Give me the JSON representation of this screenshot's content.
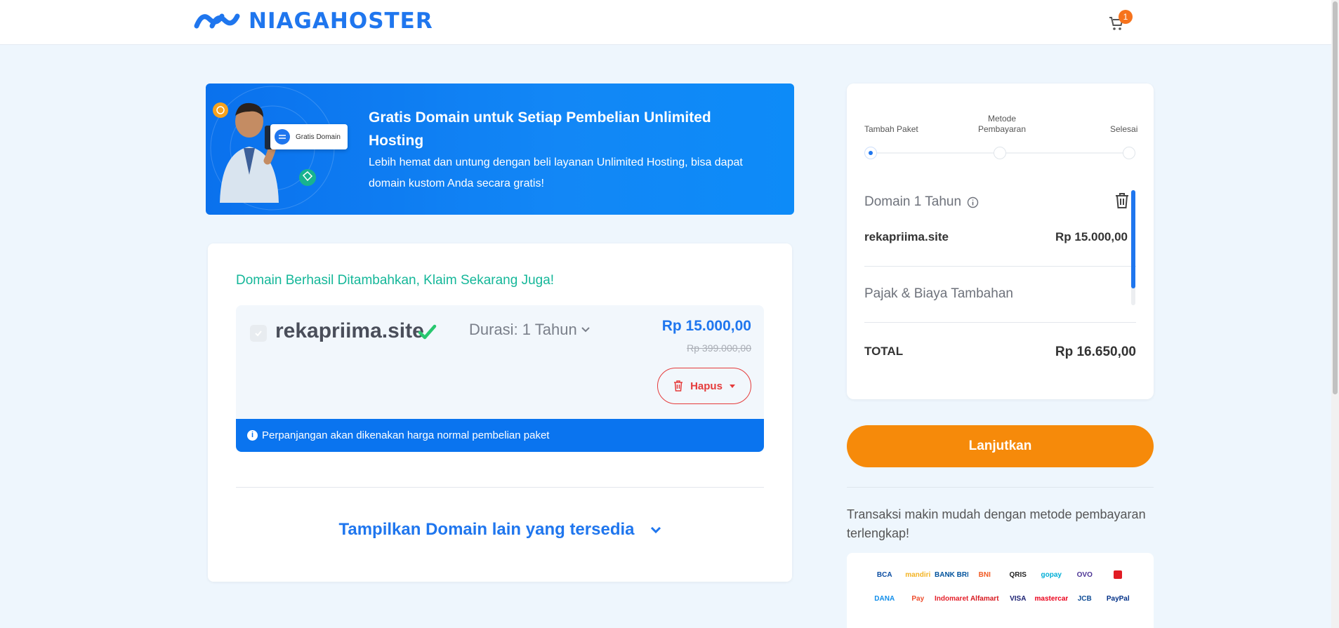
{
  "header": {
    "brand": "NIAGAHOSTER",
    "cart_count": "1"
  },
  "promo": {
    "chip_label": "Gratis Domain",
    "title": "Gratis Domain untuk Setiap Pembelian Unlimited Hosting",
    "description": "Lebih hemat dan untung dengan beli layanan Unlimited Hosting, bisa dapat domain kustom Anda secara gratis!"
  },
  "domain_card": {
    "headline": "Domain Berhasil Ditambahkan, Klaim Sekarang Juga!",
    "domain": "rekapriima.site",
    "duration": "Durasi: 1 Tahun",
    "price": "Rp 15.000,00",
    "old_price": "Rp 399.000,00",
    "delete_label": "Hapus",
    "notice": "Perpanjangan akan dikenakan harga normal pembelian paket",
    "show_more": "Tampilkan Domain lain yang tersedia"
  },
  "summary": {
    "steps": [
      {
        "label": "Tambah Paket"
      },
      {
        "label": "Metode Pembayaran"
      },
      {
        "label": "Selesai"
      }
    ],
    "domain_title": "Domain 1 Tahun",
    "item_name": "rekapriima.site",
    "item_price": "Rp 15.000,00",
    "tax_label": "Pajak & Biaya Tambahan",
    "total_label": "TOTAL",
    "total_value": "Rp 16.650,00"
  },
  "actions": {
    "continue_label": "Lanjutkan"
  },
  "payment": {
    "text": "Transaksi makin mudah dengan metode pembayaran terlengkap!",
    "methods": [
      {
        "name": "BCA",
        "color": "#0b4da2"
      },
      {
        "name": "mandiri",
        "color": "#f3b322"
      },
      {
        "name": "BANK BRI",
        "color": "#00529c"
      },
      {
        "name": "BNI",
        "color": "#f15a23"
      },
      {
        "name": "QRIS",
        "color": "#222222"
      },
      {
        "name": "gopay",
        "color": "#00aed6"
      },
      {
        "name": "OVO",
        "color": "#4c3494"
      },
      {
        "name": "",
        "color": "#e11c24"
      },
      {
        "name": "DANA",
        "color": "#118eea"
      },
      {
        "name": "Pay",
        "color": "#ee4d2d"
      },
      {
        "name": "Indomaret",
        "color": "#e4202b"
      },
      {
        "name": "Alfamart",
        "color": "#d71920"
      },
      {
        "name": "VISA",
        "color": "#1a1f71"
      },
      {
        "name": "mastercard",
        "color": "#eb001b"
      },
      {
        "name": "JCB",
        "color": "#0e4c96"
      },
      {
        "name": "PayPal",
        "color": "#003087"
      }
    ]
  },
  "colors": {
    "brand_blue": "#1f76ee",
    "success_green": "#15b799",
    "danger_red": "#e53b3b",
    "cta_orange": "#f68a0a"
  }
}
